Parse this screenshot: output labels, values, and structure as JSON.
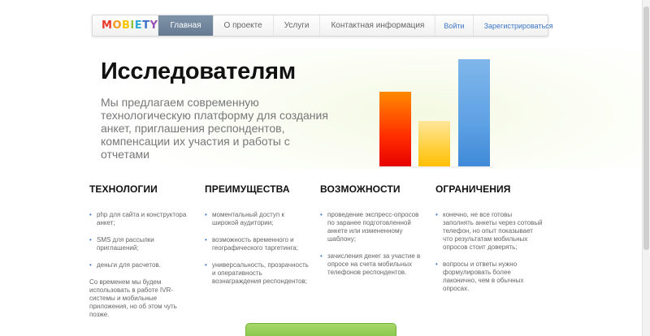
{
  "logo": {
    "letters": [
      {
        "ch": "M",
        "color": "#e8382c"
      },
      {
        "ch": "O",
        "color": "#f39a1e"
      },
      {
        "ch": "B",
        "color": "#f7c600"
      },
      {
        "ch": "I",
        "color": "#8fc33c"
      },
      {
        "ch": "E",
        "color": "#2fa9d6"
      },
      {
        "ch": "T",
        "color": "#3b6ec8"
      },
      {
        "ch": "Y",
        "color": "#9a4fb5"
      }
    ]
  },
  "nav": {
    "items": [
      "Главная",
      "О проекте",
      "Услуги",
      "Контактная информация"
    ],
    "active_index": 0,
    "login": "Войти",
    "register": "Зарегистрироваться"
  },
  "hero": {
    "title": "Исследователям",
    "text": "Мы предлагаем современную технологическую платформу для создания анкет, приглашения респондентов, компенсации их участия и работы с отчетами",
    "bars": [
      0.7,
      0.43,
      1.0
    ]
  },
  "columns": [
    {
      "title": "ТЕХНОЛОГИИ",
      "items": [
        "php для сайта и конструктора анкет;",
        "SMS для рассылки приглашений;",
        "деньги для расчетов."
      ],
      "note": "Со временем мы будем использовать в работе IVR-системы и мобильные приложения, но об этом чуть позже."
    },
    {
      "title": "ПРЕИМУЩЕСТВА",
      "items": [
        "моментальный доступ к широкой аудитории;",
        "возможность временного и географического таргетинга;",
        "универсальность, прозрачность и оперативность вознаграждения респондентов;"
      ],
      "note": ""
    },
    {
      "title": "ВОЗМОЖНОСТИ",
      "items": [
        "проведение экспресс-опросов по заранее подготовленной анкете или измененному шаблону;",
        "зачисления денег за участие в опросе на счета мобильных телефонов респондентов."
      ],
      "note": ""
    },
    {
      "title": "ОГРАНИЧЕНИЯ",
      "items": [
        "конечно, не все готовы заполнять анкеты через сотовый телефон, но опыт показывает что результатам мобильных опросов стоит доверять;",
        "вопросы и ответы нужно формулировать более лаконично, чем в обычных опросах."
      ],
      "note": ""
    }
  ]
}
